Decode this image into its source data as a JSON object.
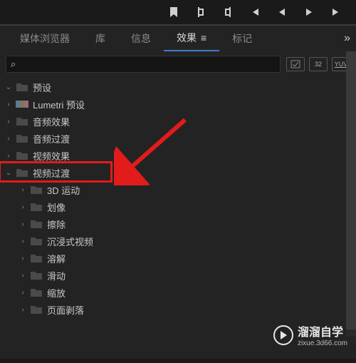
{
  "toolbar_icons": [
    "marker",
    "bracket-left",
    "bracket-right",
    "skip-start",
    "play-reverse",
    "play",
    "skip-end"
  ],
  "tabs": {
    "items": [
      {
        "label": "媒体浏览器",
        "active": false
      },
      {
        "label": "库",
        "active": false
      },
      {
        "label": "信息",
        "active": false
      },
      {
        "label": "效果",
        "active": true
      },
      {
        "label": "标记",
        "active": false
      }
    ]
  },
  "search": {
    "placeholder": ""
  },
  "badges": {
    "b1": "fx",
    "b2": "32",
    "b3": "YUV"
  },
  "tree": [
    {
      "depth": 1,
      "chev": "open",
      "icon": "folder",
      "label": "预设",
      "cut": true
    },
    {
      "depth": 1,
      "chev": "closed",
      "icon": "lumetri",
      "label": "Lumetri 预设"
    },
    {
      "depth": 1,
      "chev": "closed",
      "icon": "folder",
      "label": "音频效果"
    },
    {
      "depth": 1,
      "chev": "closed",
      "icon": "folder",
      "label": "音频过渡"
    },
    {
      "depth": 1,
      "chev": "closed",
      "icon": "folder",
      "label": "视频效果"
    },
    {
      "depth": 1,
      "chev": "open",
      "icon": "folder",
      "label": "视频过渡",
      "highlight": true
    },
    {
      "depth": 2,
      "chev": "closed",
      "icon": "folder",
      "label": "3D 运动"
    },
    {
      "depth": 2,
      "chev": "closed",
      "icon": "folder",
      "label": "划像"
    },
    {
      "depth": 2,
      "chev": "closed",
      "icon": "folder",
      "label": "擦除"
    },
    {
      "depth": 2,
      "chev": "closed",
      "icon": "folder",
      "label": "沉浸式视频"
    },
    {
      "depth": 2,
      "chev": "closed",
      "icon": "folder",
      "label": "溶解"
    },
    {
      "depth": 2,
      "chev": "closed",
      "icon": "folder",
      "label": "滑动"
    },
    {
      "depth": 2,
      "chev": "closed",
      "icon": "folder",
      "label": "缩放"
    },
    {
      "depth": 2,
      "chev": "closed",
      "icon": "folder",
      "label": "页面剥落"
    }
  ],
  "watermark": {
    "brand": "溜溜自学",
    "url": "zixue.3d66.com"
  },
  "colors": {
    "highlight": "#e21b1b",
    "arrow": "#e21b1b",
    "accent": "#3a80c8"
  }
}
